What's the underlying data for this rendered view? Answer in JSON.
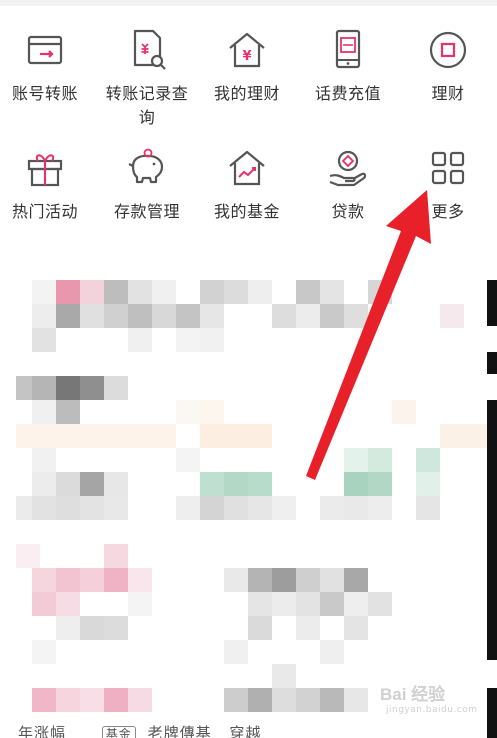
{
  "menu": {
    "row1": [
      {
        "label": "账号转账",
        "icon": "account-transfer-icon"
      },
      {
        "label": "转账记录查询",
        "icon": "transfer-record-search-icon"
      },
      {
        "label": "我的理财",
        "icon": "my-wealth-house-icon"
      },
      {
        "label": "话费充值",
        "icon": "phone-recharge-icon"
      },
      {
        "label": "理财",
        "icon": "wealth-circle-icon"
      }
    ],
    "row2": [
      {
        "label": "热门活动",
        "icon": "gift-icon"
      },
      {
        "label": "存款管理",
        "icon": "piggy-bank-icon"
      },
      {
        "label": "我的基金",
        "icon": "fund-house-chart-icon"
      },
      {
        "label": "贷款",
        "icon": "loan-hand-icon"
      },
      {
        "label": "更多",
        "icon": "more-grid-icon"
      }
    ]
  },
  "bottom": {
    "text1": "年涨幅",
    "badge": "基金",
    "text2": "老牌傳基",
    "text3": "穿越"
  },
  "watermark": {
    "brand": "Bai 经验",
    "sub": "jingyan.baidu.com"
  },
  "colors": {
    "icon_stroke": "#555555",
    "icon_accent": "#e6336a",
    "annotation_arrow": "#e8202a",
    "label_text": "#333333"
  }
}
